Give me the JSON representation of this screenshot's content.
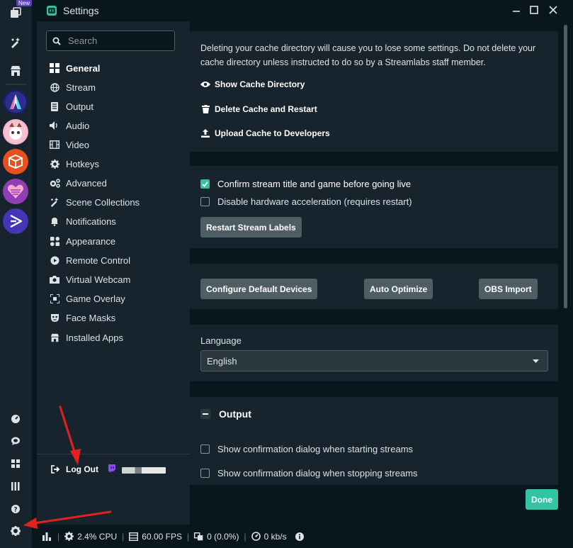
{
  "rail": {
    "new_badge": "New",
    "top_buttons": [
      "editor-icon",
      "themes-icon",
      "store-icon"
    ],
    "apps": [
      "app-a",
      "app-avatar",
      "app-box",
      "app-heart",
      "app-play"
    ],
    "bottom_buttons": [
      "dashboard-icon",
      "chat-icon",
      "layout-icon",
      "library-icon",
      "help-icon",
      "settings-icon"
    ]
  },
  "window": {
    "title": "Settings",
    "controls": [
      "minimize",
      "maximize",
      "close"
    ]
  },
  "nav": {
    "search_placeholder": "Search",
    "items": [
      {
        "label": "General",
        "icon": "grid-icon",
        "active": true
      },
      {
        "label": "Stream",
        "icon": "globe-icon"
      },
      {
        "label": "Output",
        "icon": "output-icon"
      },
      {
        "label": "Audio",
        "icon": "speaker-icon"
      },
      {
        "label": "Video",
        "icon": "film-icon"
      },
      {
        "label": "Hotkeys",
        "icon": "cog-icon"
      },
      {
        "label": "Advanced",
        "icon": "cogs-icon"
      },
      {
        "label": "Scene Collections",
        "icon": "scenes-icon"
      },
      {
        "label": "Notifications",
        "icon": "bell-icon"
      },
      {
        "label": "Appearance",
        "icon": "palette-icon"
      },
      {
        "label": "Remote Control",
        "icon": "play-circle-icon"
      },
      {
        "label": "Virtual Webcam",
        "icon": "camera-icon"
      },
      {
        "label": "Game Overlay",
        "icon": "overlay-icon"
      },
      {
        "label": "Face Masks",
        "icon": "mask-icon"
      },
      {
        "label": "Installed Apps",
        "icon": "store-icon"
      }
    ],
    "logout_label": "Log Out"
  },
  "cache": {
    "warning": "Deleting your cache directory will cause you to lose some settings. Do not delete your cache directory unless instructed to do so by a Streamlabs staff member.",
    "show": "Show Cache Directory",
    "delete": "Delete Cache and Restart",
    "upload": "Upload Cache to Developers"
  },
  "options": {
    "confirm_title": "Confirm stream title and game before going live",
    "confirm_title_checked": true,
    "disable_hw": "Disable hardware acceleration (requires restart)",
    "disable_hw_checked": false,
    "restart_labels": "Restart Stream Labels"
  },
  "devices": {
    "configure": "Configure Default Devices",
    "auto_optimize": "Auto Optimize",
    "obs_import": "OBS Import"
  },
  "language": {
    "label": "Language",
    "value": "English"
  },
  "output": {
    "title": "Output",
    "start_confirm": "Show confirmation dialog when starting streams",
    "stop_confirm": "Show confirmation dialog when stopping streams"
  },
  "done_label": "Done",
  "footer": {
    "cpu": "2.4% CPU",
    "fps": "60.00 FPS",
    "dropped": "0 (0.0%)",
    "bandwidth": "0 kb/s"
  },
  "colors": {
    "accent": "#31c3a2",
    "panel": "#17242d",
    "background": "#09161d",
    "annotation": "#e32020"
  }
}
